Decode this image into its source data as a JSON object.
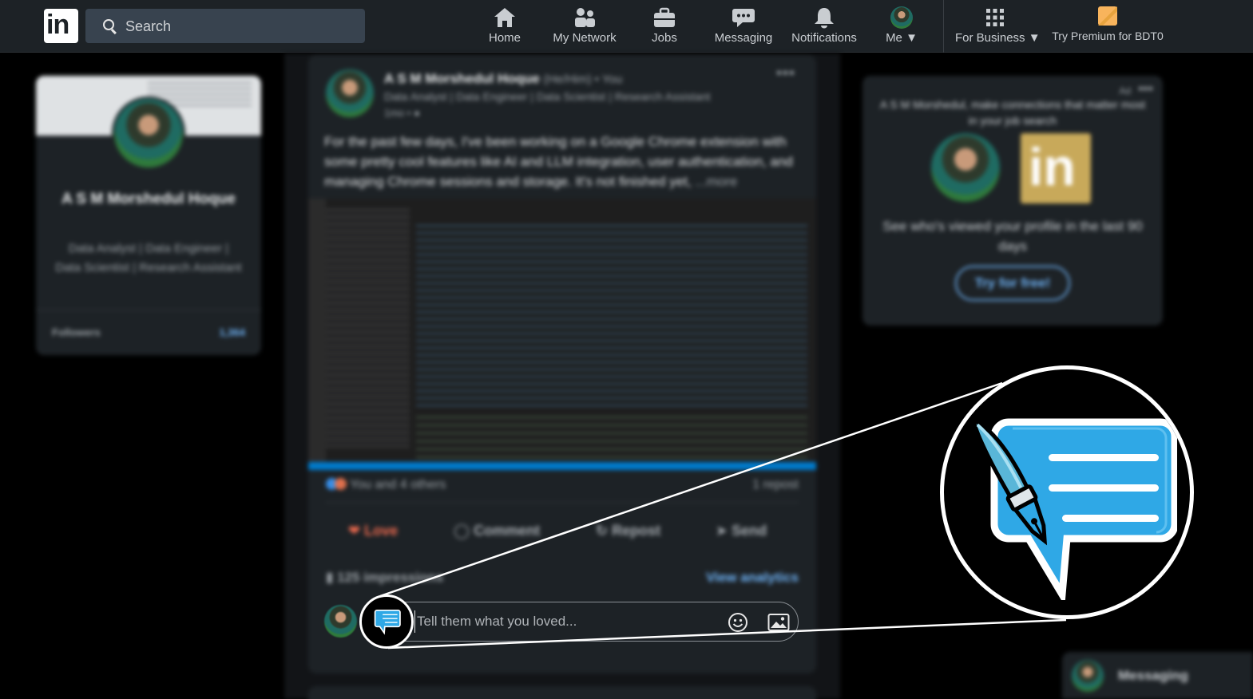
{
  "nav": {
    "logo": "in",
    "search_placeholder": "Search",
    "items": [
      {
        "label": "Home",
        "icon": "home-icon"
      },
      {
        "label": "My Network",
        "icon": "network-icon"
      },
      {
        "label": "Jobs",
        "icon": "briefcase-icon"
      },
      {
        "label": "Messaging",
        "icon": "messaging-icon"
      },
      {
        "label": "Notifications",
        "icon": "bell-icon"
      },
      {
        "label": "Me",
        "icon": "avatar"
      },
      {
        "label": "For Business",
        "icon": "grid-icon"
      },
      {
        "label": "Try Premium for BDT0",
        "icon": "premium-icon"
      }
    ]
  },
  "profile": {
    "name": "A S M Morshedul Hoque",
    "headline": "Data Analyst | Data Engineer | Data Scientist | Research Assistant",
    "followers_label": "Followers",
    "followers_count": "1,364"
  },
  "post": {
    "author": "A S M Morshedul Hoque",
    "pronouns": "(He/Him) • You",
    "headline": "Data Analyst | Data Engineer | Data Scientist | Research Assistant",
    "time": "1mo •",
    "body": "For the past few days, I've been working on a Google Chrome extension with some pretty cool features like AI and LLM integration, user authentication, and managing Chrome sessions and storage. It's not finished yet,",
    "more": "...more",
    "reactions": "You and 4 others",
    "reposts": "1 repost",
    "actions": {
      "love": "Love",
      "comment": "Comment",
      "repost": "Repost",
      "send": "Send"
    },
    "impressions": "125 impressions",
    "view_analytics": "View analytics"
  },
  "comment": {
    "placeholder": "Tell them what you loved..."
  },
  "ad": {
    "tag": "Ad",
    "title": "A S M Morshedul, make connections that matter most in your job search",
    "logo": "in",
    "text": "See who's viewed your profile in the last 90 days",
    "button": "Try for free!"
  },
  "messaging_bar": {
    "label": "Messaging"
  },
  "colors": {
    "nav_bg": "#1d2226",
    "card_bg": "#1d2226",
    "link_blue": "#70b5f9",
    "extension_blue": "#2fa8e6",
    "love_red": "#f26b4f"
  }
}
